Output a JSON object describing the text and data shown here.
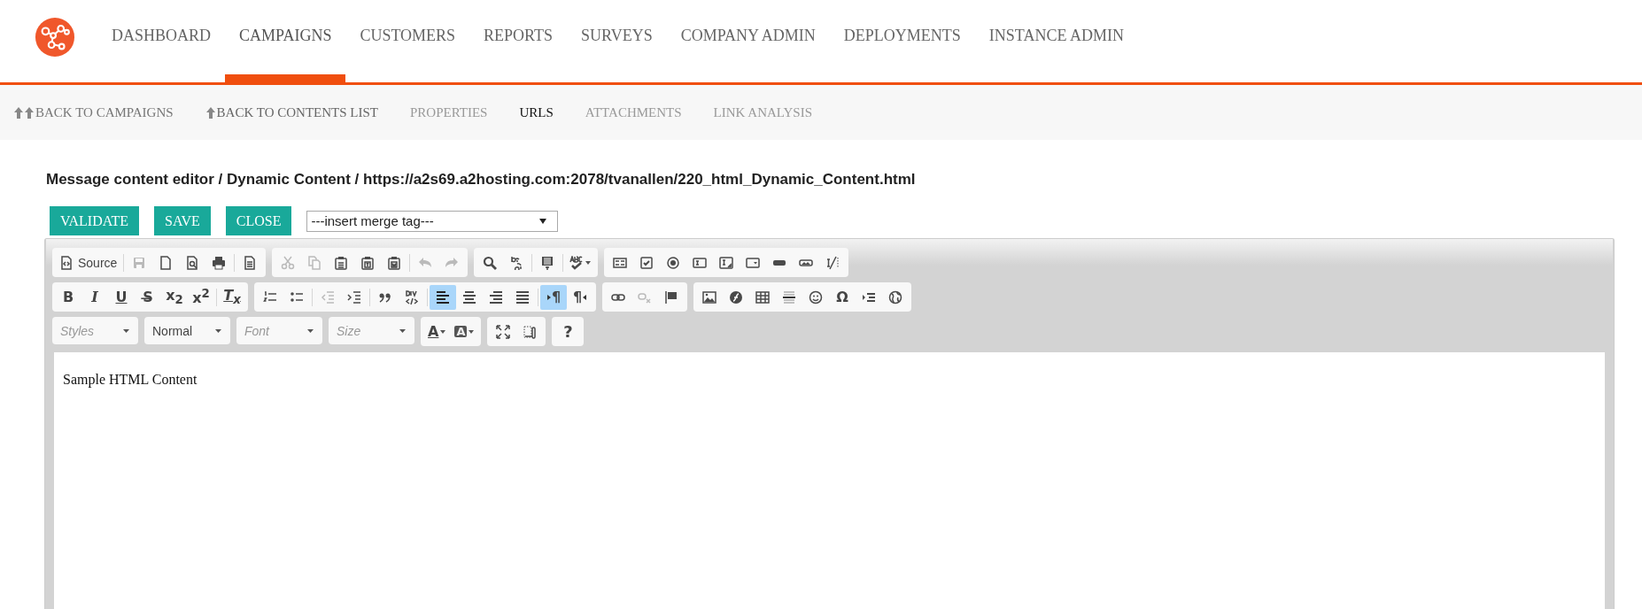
{
  "nav": {
    "items": [
      {
        "label": "DASHBOARD",
        "selected": false
      },
      {
        "label": "CAMPAIGNS",
        "selected": true
      },
      {
        "label": "CUSTOMERS",
        "selected": false
      },
      {
        "label": "REPORTS",
        "selected": false
      },
      {
        "label": "SURVEYS",
        "selected": false
      },
      {
        "label": "COMPANY ADMIN",
        "selected": false
      },
      {
        "label": "DEPLOYMENTS",
        "selected": false
      },
      {
        "label": "INSTANCE ADMIN",
        "selected": false
      }
    ]
  },
  "subnav": {
    "items": [
      {
        "kind": "back-all",
        "label": "BACK TO CAMPAIGNS",
        "selected": false
      },
      {
        "kind": "back",
        "label": "BACK TO CONTENTS LIST",
        "selected": false
      },
      {
        "kind": "tab",
        "label": "PROPERTIES",
        "selected": false
      },
      {
        "kind": "tab",
        "label": "URLS",
        "selected": true
      },
      {
        "kind": "tab",
        "label": "ATTACHMENTS",
        "selected": false
      },
      {
        "kind": "tab",
        "label": "LINK ANALYSIS",
        "selected": false
      }
    ]
  },
  "breadcrumb": "Message content editor / Dynamic Content / https://a2s69.a2hosting.com:2078/tvanallen/220_html_Dynamic_Content.html",
  "actions": [
    "VALIDATE",
    "SAVE",
    "CLOSE"
  ],
  "merge_tag": {
    "value": "---insert merge tag---"
  },
  "editor": {
    "toolbar": [
      [
        [
          {
            "kind": "source",
            "text": "Source",
            "disabled": false,
            "selected": false
          },
          {
            "kind": "sep"
          },
          {
            "kind": "save",
            "disabled": true,
            "selected": false
          },
          {
            "kind": "newpage",
            "disabled": false,
            "selected": false
          },
          {
            "kind": "preview",
            "disabled": false,
            "selected": false
          },
          {
            "kind": "print",
            "disabled": false,
            "selected": false
          },
          {
            "kind": "sep"
          },
          {
            "kind": "templates",
            "disabled": false,
            "selected": false
          }
        ],
        [
          {
            "kind": "cut",
            "disabled": true,
            "selected": false
          },
          {
            "kind": "copy",
            "disabled": true,
            "selected": false
          },
          {
            "kind": "paste",
            "disabled": false,
            "selected": false
          },
          {
            "kind": "pastetext",
            "disabled": false,
            "selected": false
          },
          {
            "kind": "pasteword",
            "disabled": false,
            "selected": false
          },
          {
            "kind": "sep"
          },
          {
            "kind": "undo",
            "disabled": true,
            "selected": false
          },
          {
            "kind": "redo",
            "disabled": true,
            "selected": false
          }
        ],
        [
          {
            "kind": "find",
            "disabled": false,
            "selected": false
          },
          {
            "kind": "replace",
            "disabled": false,
            "selected": false
          },
          {
            "kind": "sep"
          },
          {
            "kind": "selectall",
            "disabled": false,
            "selected": false
          },
          {
            "kind": "sep"
          },
          {
            "kind": "spellcheck",
            "disabled": false,
            "selected": false
          }
        ],
        [
          {
            "kind": "form",
            "disabled": false,
            "selected": false
          },
          {
            "kind": "checkbox",
            "disabled": false,
            "selected": false
          },
          {
            "kind": "radio",
            "disabled": false,
            "selected": false
          },
          {
            "kind": "textfield",
            "disabled": false,
            "selected": false
          },
          {
            "kind": "textarea",
            "disabled": false,
            "selected": false
          },
          {
            "kind": "select",
            "disabled": false,
            "selected": false
          },
          {
            "kind": "button",
            "disabled": false,
            "selected": false
          },
          {
            "kind": "imagebutton",
            "disabled": false,
            "selected": false
          },
          {
            "kind": "hiddenfield",
            "disabled": false,
            "selected": false
          }
        ]
      ],
      [
        [
          {
            "kind": "bold",
            "text": "B",
            "disabled": false,
            "selected": false
          },
          {
            "kind": "italic",
            "text": "I",
            "disabled": false,
            "selected": false
          },
          {
            "kind": "underline",
            "text": "U",
            "disabled": false,
            "selected": false
          },
          {
            "kind": "strike",
            "text": "S̶",
            "disabled": false,
            "selected": false
          },
          {
            "kind": "subscript",
            "text": "x$_{2}$",
            "disabled": false,
            "selected": false
          },
          {
            "kind": "superscript",
            "text": "x$^{2}$",
            "disabled": false,
            "selected": false
          },
          {
            "kind": "sep"
          },
          {
            "kind": "removeformat",
            "text": "T$_{x}$",
            "disabled": false,
            "selected": false
          }
        ],
        [
          {
            "kind": "numberedlist",
            "disabled": false,
            "selected": false
          },
          {
            "kind": "bulletlist",
            "disabled": false,
            "selected": false
          },
          {
            "kind": "sep"
          },
          {
            "kind": "outdent",
            "disabled": true,
            "selected": false
          },
          {
            "kind": "indent",
            "disabled": false,
            "selected": false
          },
          {
            "kind": "sep"
          },
          {
            "kind": "blockquote",
            "disabled": false,
            "selected": false
          },
          {
            "kind": "creatediv",
            "disabled": false,
            "selected": false
          },
          {
            "kind": "sep"
          },
          {
            "kind": "alignleft",
            "disabled": false,
            "selected": true
          },
          {
            "kind": "aligncenter",
            "disabled": false,
            "selected": false
          },
          {
            "kind": "alignright",
            "disabled": false,
            "selected": false
          },
          {
            "kind": "justify",
            "disabled": false,
            "selected": false
          },
          {
            "kind": "sep"
          },
          {
            "kind": "ltr",
            "text": "¶",
            "disabled": false,
            "selected": true
          },
          {
            "kind": "rtl",
            "text": "¶",
            "disabled": false,
            "selected": false
          }
        ],
        [
          {
            "kind": "link",
            "disabled": false,
            "selected": false
          },
          {
            "kind": "unlink",
            "disabled": true,
            "selected": false
          },
          {
            "kind": "anchor",
            "disabled": false,
            "selected": false
          }
        ],
        [
          {
            "kind": "image",
            "disabled": false,
            "selected": false
          },
          {
            "kind": "flash",
            "disabled": false,
            "selected": false
          },
          {
            "kind": "table",
            "disabled": false,
            "selected": false
          },
          {
            "kind": "hline",
            "disabled": false,
            "selected": false
          },
          {
            "kind": "smiley",
            "disabled": false,
            "selected": false
          },
          {
            "kind": "specialchar",
            "text": "Ω",
            "disabled": false,
            "selected": false
          },
          {
            "kind": "pagebreak",
            "disabled": false,
            "selected": false
          },
          {
            "kind": "iframe",
            "disabled": false,
            "selected": false
          }
        ]
      ],
      [
        [
          {
            "kind": "combo",
            "placeholder": "Styles"
          }
        ],
        [
          {
            "kind": "combo",
            "value": "Normal"
          }
        ],
        [
          {
            "kind": "combo",
            "placeholder": "Font"
          }
        ],
        [
          {
            "kind": "combo",
            "placeholder": "Size"
          }
        ],
        [
          {
            "kind": "textcolor",
            "text": "A",
            "disabled": false,
            "selected": false
          },
          {
            "kind": "bgcolor",
            "text": "A",
            "disabled": false,
            "selected": false
          }
        ],
        [
          {
            "kind": "maximize",
            "disabled": false,
            "selected": false
          },
          {
            "kind": "showblocks",
            "disabled": false,
            "selected": false
          }
        ],
        [
          {
            "kind": "about",
            "text": "?",
            "disabled": false,
            "selected": false
          }
        ]
      ]
    ],
    "content": "Sample HTML Content"
  }
}
